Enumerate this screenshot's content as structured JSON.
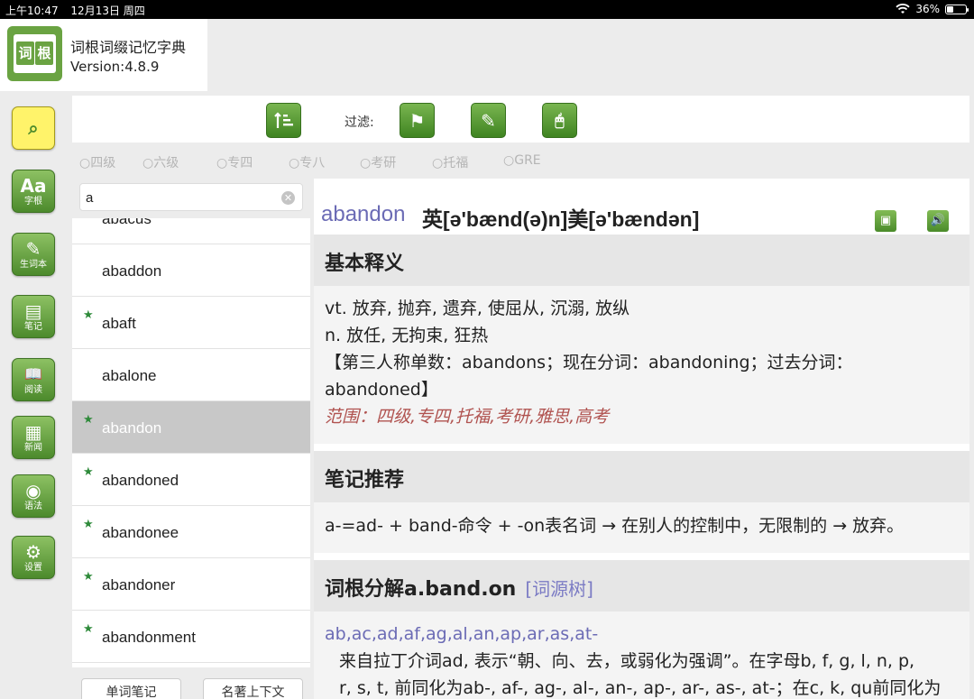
{
  "status_bar": {
    "time": "上午10:47",
    "date": "12月13日 周四",
    "battery": "36%",
    "battery_level": 0.36
  },
  "app": {
    "logo_text_left": "词",
    "logo_text_right": "根",
    "name": "词根词缀记忆字典",
    "version": "Version:4.8.9"
  },
  "nav": [
    {
      "icon": "magnifier-book-icon",
      "glyph": "⌕",
      "label": "",
      "active": true
    },
    {
      "icon": "root-icon",
      "glyph": "Aa",
      "label": "字根"
    },
    {
      "icon": "vocabulary-book-icon",
      "glyph": "✎",
      "label": "生词本"
    },
    {
      "icon": "notes-icon",
      "glyph": "▤",
      "label": "笔记"
    },
    {
      "icon": "reading-icon",
      "glyph": "📖",
      "label": "阅读"
    },
    {
      "icon": "news-icon",
      "glyph": "▦",
      "label": "新闻"
    },
    {
      "icon": "globe-icon",
      "glyph": "◉",
      "label": "语法"
    },
    {
      "icon": "gear-icon",
      "glyph": "⚙",
      "label": "设置"
    }
  ],
  "toolbar": {
    "sort_icon": "sort-icon",
    "filter_label": "过滤:",
    "filter_buttons": [
      {
        "icon": "flag-icon",
        "glyph": "⚑"
      },
      {
        "icon": "edit-icon",
        "glyph": "✎"
      },
      {
        "icon": "mouse-icon",
        "glyph": "🖱"
      }
    ]
  },
  "levels": [
    "○四级",
    "○六级",
    "○专四",
    "○专八",
    "○考研",
    "○托福",
    "○GRE"
  ],
  "search": {
    "value": "a",
    "placeholder": ""
  },
  "words": [
    {
      "word": "abacus",
      "star": false,
      "selected": false
    },
    {
      "word": "abaddon",
      "star": false,
      "selected": false
    },
    {
      "word": "abaft",
      "star": true,
      "selected": false
    },
    {
      "word": "abalone",
      "star": false,
      "selected": false
    },
    {
      "word": "abandon",
      "star": true,
      "selected": true
    },
    {
      "word": "abandoned",
      "star": true,
      "selected": false
    },
    {
      "word": "abandonee",
      "star": true,
      "selected": false
    },
    {
      "word": "abandoner",
      "star": true,
      "selected": false
    },
    {
      "word": "abandonment",
      "star": true,
      "selected": false
    }
  ],
  "bottom_buttons": [
    "单词笔记",
    "名著上下文"
  ],
  "detail": {
    "word": "abandon",
    "phonetic": "英[ə'bænd(ə)n]美[ə'bændən]",
    "add_icon": "add-folder-icon",
    "sound_icon": "speaker-icon",
    "sections": {
      "basic": {
        "title": "基本释义",
        "lines": [
          "vt. 放弃, 抛弃, 遗弃, 使屈从, 沉溺, 放纵",
          "n. 放任, 无拘束, 狂热",
          "【第三人称单数：abandons；现在分词：abandoning；过去分词：",
          "abandoned】"
        ],
        "range": "范围：四级,专四,托福,考研,雅思,高考"
      },
      "notes": {
        "title": "笔记推荐",
        "text": "a-=ad- + band-命令 + -on表名词 → 在别人的控制中，无限制的 → 放弃。"
      },
      "etymology": {
        "title": "词根分解a.band.on",
        "link": "[词源树]",
        "prefixes": "ab,ac,ad,af,ag,al,an,ap,ar,as,at-",
        "lines": [
          "来自拉丁介词ad, 表示“朝、向、去，或弱化为强调”。在字母b, f, g, l, n, p,",
          "r, s, t, 前同化为ab-, af-, ag-, al-, an-, ap-, ar-, as-, at-；在c, k, qu前同化为"
        ]
      }
    }
  }
}
